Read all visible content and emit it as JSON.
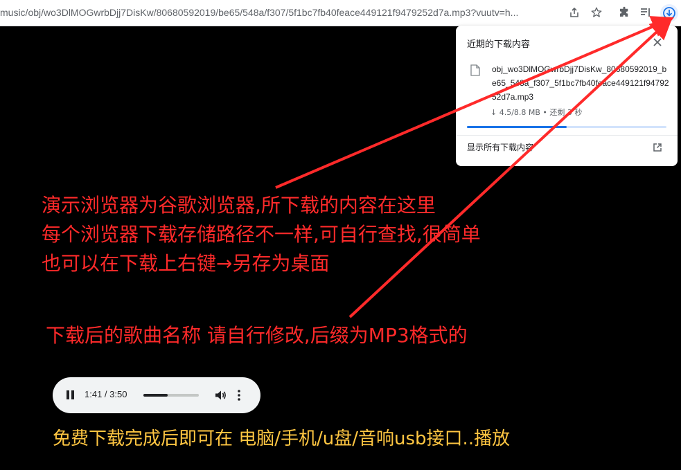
{
  "browser": {
    "url": "music/obj/wo3DlMOGwrbDjj7DisKw/80680592019/be65/548a/f307/5f1bc7fb40feace449121f9479252d7a.mp3?vuutv=h...",
    "icons": [
      "share-icon",
      "star-icon",
      "extensions-icon",
      "reading-list-icon",
      "download-icon"
    ]
  },
  "download_bubble": {
    "title": "近期的下载内容",
    "filename": "obj_wo3DlMOGwrbDjj7DisKw_80680592019_be65_548a_f307_5f1bc7fb40feace449121f9479252d7a.mp3",
    "status": "↓ 4.5/8.8 MB • 还剩 3 秒",
    "progress": 0.5,
    "show_all": "显示所有下载内容"
  },
  "annotations": {
    "line1": "演示浏览器为谷歌浏览器,所下载的内容在这里",
    "line2": "每个浏览器下载存储路径不一样,可自行查找,很简单",
    "line3": "也可以在下载上右键→另存为桌面",
    "line4": "下载后的歌曲名称 请自行修改,后缀为MP3格式的"
  },
  "player": {
    "time": "1:41 / 3:50",
    "progress": 0.44
  },
  "footer": "免费下载完成后即可在 电脑/手机/u盘/音响usb接口..播放",
  "colors": {
    "annotation": "#ff2a2a",
    "footer": "#ffc642",
    "accent": "#1a73e8"
  }
}
